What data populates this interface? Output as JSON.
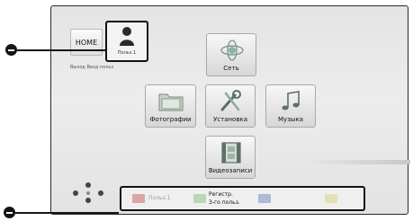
{
  "header": {
    "home_label": "HOME",
    "user_name": "Польз.1",
    "login_text": "Выход Ввод польз"
  },
  "menu": {
    "network": "Сеть",
    "photos": "Фотографии",
    "setup": "Установка",
    "music": "Музыка",
    "video": "Видеозаписи"
  },
  "footer": {
    "user_hint": "Польз.1",
    "register_line1": "Регистр.",
    "register_line2": "З-го польз."
  },
  "colors": {
    "red_button": "#d9a6a6",
    "green_button": "#b8d8b4",
    "blue_button": "#b0b8d8",
    "yellow_button": "#e4e0b6"
  }
}
